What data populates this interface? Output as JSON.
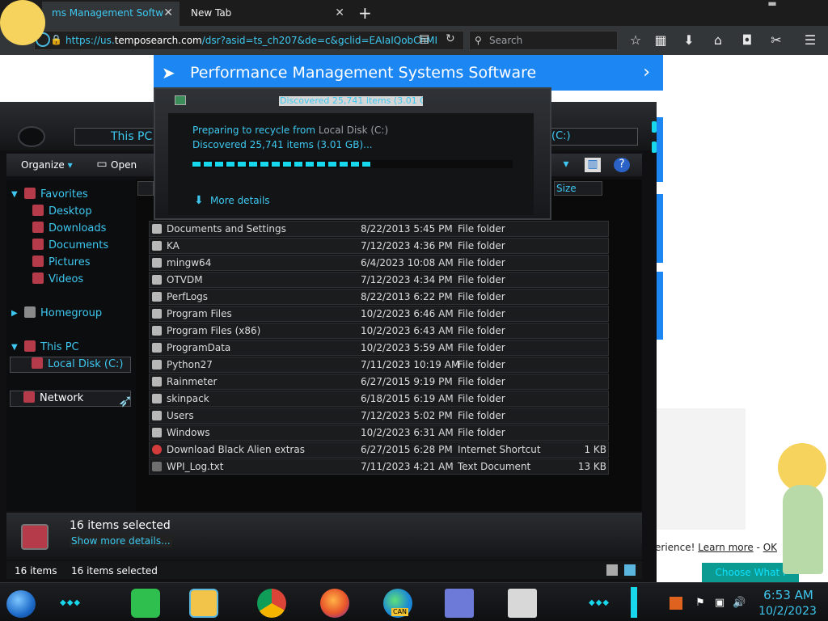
{
  "browser": {
    "tabs": [
      {
        "label": "ms Management Softw"
      },
      {
        "label": "New Tab"
      }
    ],
    "tab_close": "✕",
    "new_tab": "+",
    "url": {
      "prefix": "https://us.",
      "host": "temposearch.com",
      "rest": "/dsr?asid=ts_ch207&de=c&gclid=EAIaIQobChMI"
    },
    "search_placeholder": "Search"
  },
  "webpage": {
    "ad_title": "Performance Management Systems Software",
    "cookie_prefix": "erience!",
    "cookie_learn": "Learn more",
    "cookie_sep": "-",
    "cookie_ok": "OK",
    "choose_button": "Choose What I Share"
  },
  "explorer": {
    "address": "This PC",
    "address_right": "(C:)",
    "toolbar": {
      "organize": "Organize",
      "open": "Open"
    },
    "size_column": "Size",
    "nav": {
      "favorites": "Favorites",
      "desktop": "Desktop",
      "downloads": "Downloads",
      "documents": "Documents",
      "pictures": "Pictures",
      "videos": "Videos",
      "homegroup": "Homegroup",
      "this_pc": "This PC",
      "local_disk": "Local Disk (C:)",
      "network": "Network"
    },
    "files": [
      {
        "name": "Documents and Settings",
        "date": "8/22/2013 5:45 PM",
        "type": "File folder",
        "size": ""
      },
      {
        "name": "KA",
        "date": "7/12/2023 4:36 PM",
        "type": "File folder",
        "size": ""
      },
      {
        "name": "mingw64",
        "date": "6/4/2023 10:08 AM",
        "type": "File folder",
        "size": ""
      },
      {
        "name": "OTVDM",
        "date": "7/12/2023 4:34 PM",
        "type": "File folder",
        "size": ""
      },
      {
        "name": "PerfLogs",
        "date": "8/22/2013 6:22 PM",
        "type": "File folder",
        "size": ""
      },
      {
        "name": "Program Files",
        "date": "10/2/2023 6:46 AM",
        "type": "File folder",
        "size": ""
      },
      {
        "name": "Program Files (x86)",
        "date": "10/2/2023 6:43 AM",
        "type": "File folder",
        "size": ""
      },
      {
        "name": "ProgramData",
        "date": "10/2/2023 5:59 AM",
        "type": "File folder",
        "size": ""
      },
      {
        "name": "Python27",
        "date": "7/11/2023 10:19 AM",
        "type": "File folder",
        "size": ""
      },
      {
        "name": "Rainmeter",
        "date": "6/27/2015 9:19 PM",
        "type": "File folder",
        "size": ""
      },
      {
        "name": "skinpack",
        "date": "6/18/2015 6:19 AM",
        "type": "File folder",
        "size": ""
      },
      {
        "name": "Users",
        "date": "7/12/2023 5:02 PM",
        "type": "File folder",
        "size": ""
      },
      {
        "name": "Windows",
        "date": "10/2/2023 6:31 AM",
        "type": "File folder",
        "size": ""
      },
      {
        "name": "Download Black Alien extras",
        "date": "6/27/2015 6:28 PM",
        "type": "Internet Shortcut",
        "size": "1 KB"
      },
      {
        "name": "WPI_Log.txt",
        "date": "7/11/2023 4:21 AM",
        "type": "Text Document",
        "size": "13 KB"
      }
    ],
    "details_title": "16 items selected",
    "details_link": "Show more details...",
    "status_items": "16 items",
    "status_selected": "16 items selected"
  },
  "dialog": {
    "title": "Discovered 25,741 items (3.01 GB)",
    "line1_prefix": "Preparing to recycle from",
    "line1_location": "Local Disk (C:)",
    "line2": "Discovered 25,741 items (3.01 GB)...",
    "progress": 0.56,
    "more_details": "More details"
  },
  "taskbar": {
    "time": "6:53 AM",
    "date": "10/2/2023",
    "edge_badge": "CAN"
  },
  "colors": {
    "accent_cyan": "#3ec8f0",
    "neon": "#18d6ec",
    "banner_blue": "#1c86f2",
    "folder_red": "#b53a4a"
  }
}
